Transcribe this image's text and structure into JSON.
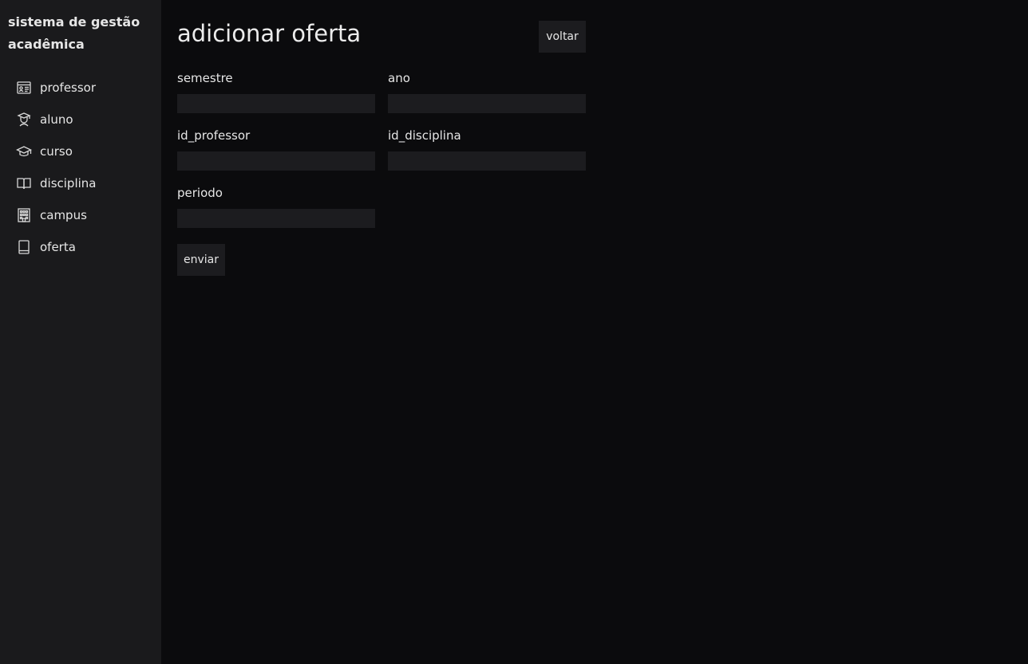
{
  "sidebar": {
    "brand": "sistema de gestão acadêmica",
    "items": [
      {
        "label": "professor",
        "icon": "id-card-icon"
      },
      {
        "label": "aluno",
        "icon": "student-icon"
      },
      {
        "label": "curso",
        "icon": "graduation-cap-icon"
      },
      {
        "label": "disciplina",
        "icon": "open-book-icon"
      },
      {
        "label": "campus",
        "icon": "building-icon"
      },
      {
        "label": "oferta",
        "icon": "book-icon"
      }
    ]
  },
  "main": {
    "title": "adicionar oferta",
    "back_label": "voltar",
    "fields": {
      "semestre": {
        "label": "semestre",
        "value": ""
      },
      "ano": {
        "label": "ano",
        "value": ""
      },
      "id_professor": {
        "label": "id_professor",
        "value": ""
      },
      "id_disciplina": {
        "label": "id_disciplina",
        "value": ""
      },
      "periodo": {
        "label": "periodo",
        "value": ""
      }
    },
    "submit_label": "enviar"
  },
  "colors": {
    "sidebar_bg": "#1a1a1c",
    "main_bg": "#0b0b0d",
    "input_bg": "#1c1c1f",
    "text": "#e6e6e6"
  }
}
